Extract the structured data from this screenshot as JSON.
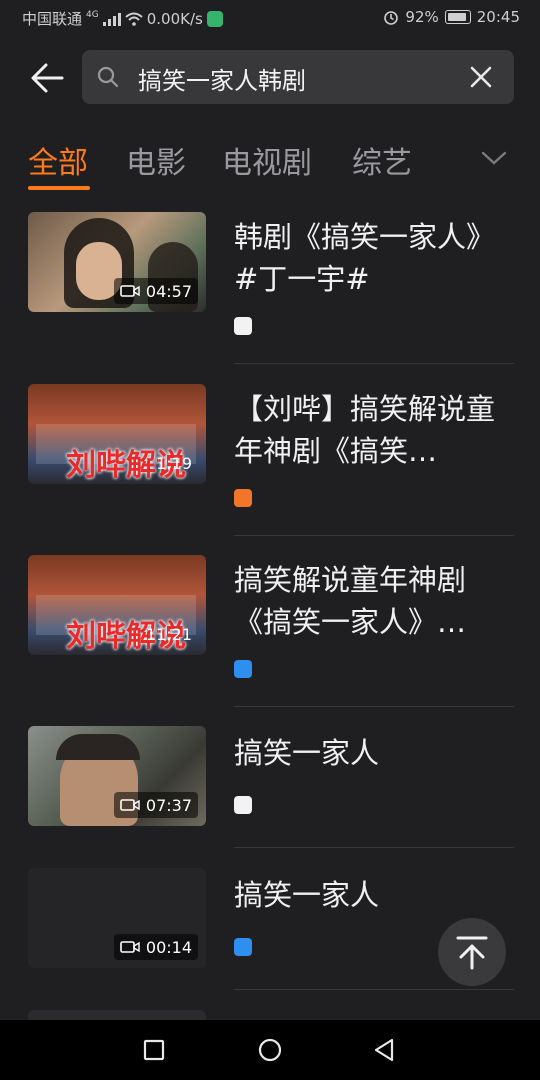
{
  "status": {
    "carrier": "中国联通",
    "network": "4G",
    "speed": "0.00K/s",
    "battery": "92%",
    "time": "20:45"
  },
  "search": {
    "query": "搞笑一家人韩剧"
  },
  "tabs": [
    {
      "label": "全部",
      "active": true
    },
    {
      "label": "电影",
      "active": false
    },
    {
      "label": "电视剧",
      "active": false
    },
    {
      "label": "综艺",
      "active": false
    }
  ],
  "results": [
    {
      "title": "韩剧《搞笑一家人》#丁一宇#",
      "duration": "04:57",
      "source_icon": "weibo-icon",
      "thumb_overlay": ""
    },
    {
      "title": "【刘哔】搞笑解说童年神剧《搞笑…",
      "duration": "1:19",
      "source_icon": "orange-app-icon",
      "thumb_overlay": "刘哔解说"
    },
    {
      "title": "搞笑解说童年神剧《搞笑一家人》…",
      "duration": "11:21",
      "source_icon": "blue-app-icon",
      "thumb_overlay": "刘哔解说"
    },
    {
      "title": "搞笑一家人",
      "duration": "07:37",
      "source_icon": "weibo-icon",
      "thumb_overlay": ""
    },
    {
      "title": "搞笑一家人",
      "duration": "00:14",
      "source_icon": "blue-app-icon",
      "thumb_overlay": ""
    }
  ],
  "colors": {
    "accent": "#ff7a1a",
    "background": "#1f1f22"
  }
}
